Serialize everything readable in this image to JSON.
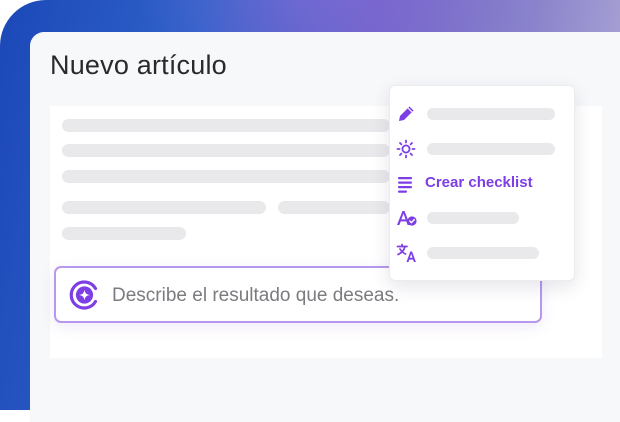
{
  "editor": {
    "title": "Nuevo artículo"
  },
  "prompt": {
    "placeholder": "Describe el resultado que deseas.",
    "icon": "ai-sparkle-icon"
  },
  "menu": {
    "items": [
      {
        "icon": "pen-icon",
        "label": ""
      },
      {
        "icon": "sun-icon",
        "label": ""
      },
      {
        "icon": "list-icon",
        "label": "Crear checklist"
      },
      {
        "icon": "spell-check-icon",
        "label": ""
      },
      {
        "icon": "translate-icon",
        "label": ""
      }
    ]
  },
  "colors": {
    "accent": "#7d3ee6",
    "accent_border": "#b897ee",
    "placeholder_bar": "#e9e9ec"
  }
}
